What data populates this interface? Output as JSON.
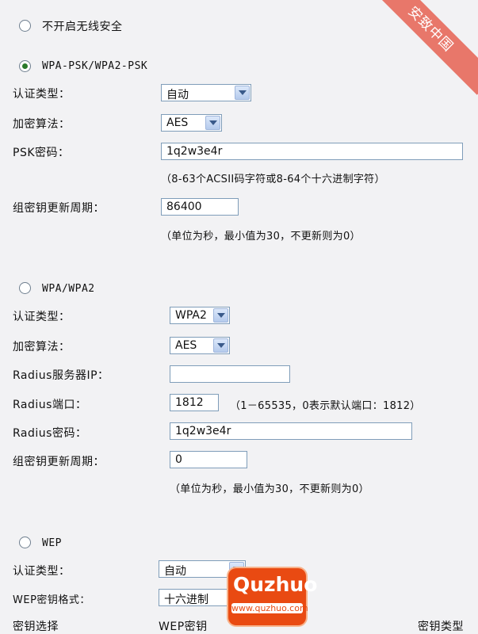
{
  "corner_badge": "安致中国",
  "options": {
    "no_security": "不开启无线安全",
    "wpa_psk": "WPA-PSK/WPA2-PSK",
    "wpa": "WPA/WPA2",
    "wep": "WEP"
  },
  "psk": {
    "auth_label": "认证类型：",
    "auth_value": "自动",
    "enc_label": "加密算法：",
    "enc_value": "AES",
    "psk_label": "PSK密码：",
    "psk_value": "1q2w3e4r",
    "psk_hint": "（8-63个ACSII码字符或8-64个十六进制字符）",
    "period_label": "组密钥更新周期：",
    "period_value": "86400",
    "period_hint": "（单位为秒，最小值为30，不更新则为0）"
  },
  "wpa": {
    "auth_label": "认证类型：",
    "auth_value": "WPA2",
    "enc_label": "加密算法：",
    "enc_value": "AES",
    "ip_label": "Radius服务器IP：",
    "ip_value": "",
    "port_label": "Radius端口：",
    "port_value": "1812",
    "port_hint": "（1－65535，0表示默认端口：1812）",
    "pwd_label": "Radius密码：",
    "pwd_value": "1q2w3e4r",
    "period_label": "组密钥更新周期：",
    "period_value": "0",
    "period_hint": "（单位为秒，最小值为30，不更新则为0）"
  },
  "wep": {
    "auth_label": "认证类型：",
    "auth_value": "自动",
    "format_label": "WEP密钥格式：",
    "format_value": "十六进制",
    "col_key_select": "密钥选择",
    "col_wep_key": "WEP密钥",
    "col_key_type": "密钥类型"
  },
  "watermark": {
    "brand": "Quzhuo",
    "url": "www.quzhuo.com"
  },
  "colors": {
    "background": "#f2f2f4",
    "corner": "#e8776a",
    "watermark": "#e94a12"
  }
}
